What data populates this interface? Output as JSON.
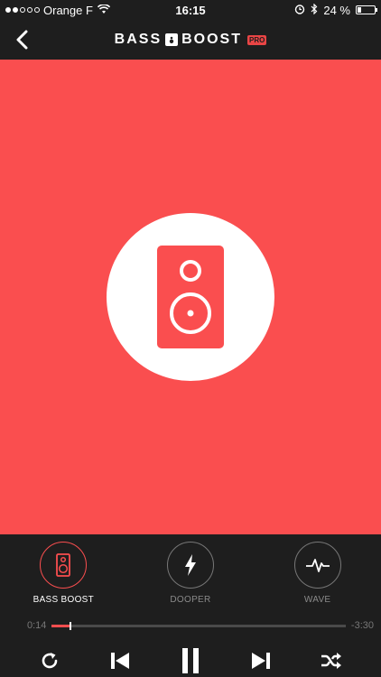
{
  "status_bar": {
    "carrier": "Orange F",
    "time": "16:15",
    "battery": "24 %",
    "battery_level": 0.24
  },
  "nav": {
    "logo_left": "BASS",
    "logo_right": "BOOST",
    "logo_badge": "PRO"
  },
  "colors": {
    "accent": "#fa4e4f",
    "bar_bg": "#1e1e1e"
  },
  "modes": [
    {
      "label": "BASS BOOST",
      "icon": "speaker-icon",
      "active": true
    },
    {
      "label": "DOOPER",
      "icon": "lightning-icon",
      "active": false
    },
    {
      "label": "WAVE",
      "icon": "pulse-icon",
      "active": false
    }
  ],
  "playback": {
    "elapsed": "0:14",
    "remaining": "-3:30",
    "progress": 0.06
  }
}
